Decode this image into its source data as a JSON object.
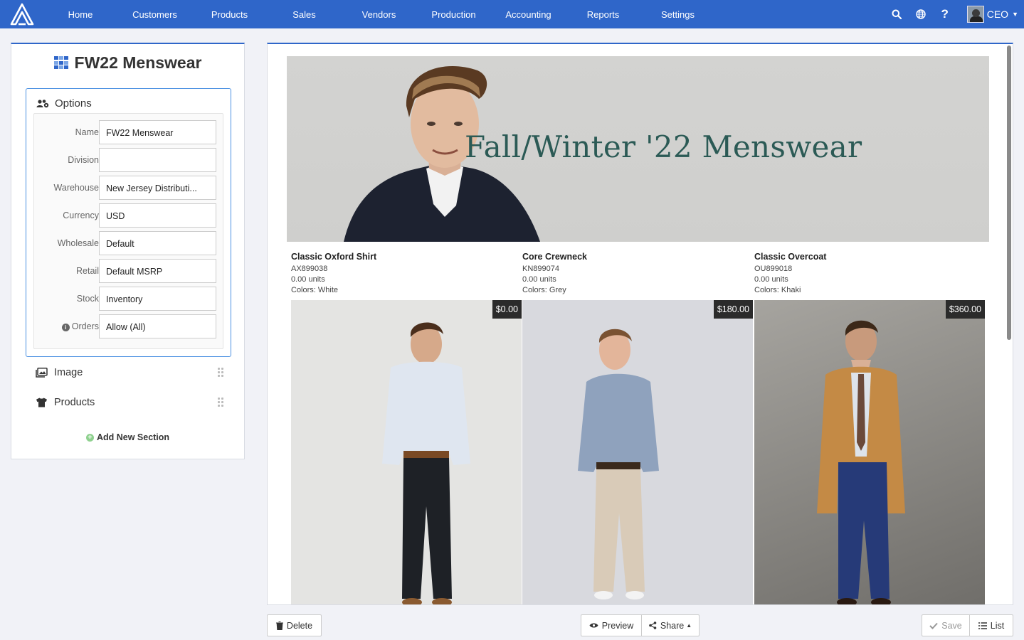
{
  "nav": {
    "items": [
      "Home",
      "Customers",
      "Products",
      "Sales",
      "Vendors",
      "Production",
      "Accounting",
      "Reports",
      "Settings"
    ],
    "user_label": "CEO"
  },
  "sidebar": {
    "title": "FW22 Menswear",
    "options_label": "Options",
    "fields": [
      {
        "label": "Name",
        "value": "FW22 Menswear"
      },
      {
        "label": "Division",
        "value": ""
      },
      {
        "label": "Warehouse",
        "value": "New Jersey Distributi..."
      },
      {
        "label": "Currency",
        "value": "USD"
      },
      {
        "label": "Wholesale",
        "value": "Default"
      },
      {
        "label": "Retail",
        "value": "Default MSRP"
      },
      {
        "label": "Stock",
        "value": "Inventory"
      },
      {
        "label": "Orders",
        "value": "Allow (All)"
      }
    ],
    "sections": [
      "Image",
      "Products"
    ],
    "add_section_label": "Add New Section"
  },
  "preview": {
    "hero_title": "Fall/Winter '22 Menswear",
    "products": [
      {
        "name": "Classic Oxford Shirt",
        "sku": "AX899038",
        "units": "0.00 units",
        "colors": "Colors: White",
        "price": "$0.00"
      },
      {
        "name": "Core Crewneck",
        "sku": "KN899074",
        "units": "0.00 units",
        "colors": "Colors: Grey",
        "price": "$180.00"
      },
      {
        "name": "Classic Overcoat",
        "sku": "OU899018",
        "units": "0.00 units",
        "colors": "Colors: Khaki",
        "price": "$360.00"
      }
    ]
  },
  "actions": {
    "delete_label": "Delete",
    "preview_label": "Preview",
    "share_label": "Share",
    "save_label": "Save",
    "list_label": "List"
  },
  "colors": {
    "brand_blue": "#2f66c9",
    "page_bg": "#f1f2f7",
    "title_teal": "#2b5a55"
  }
}
